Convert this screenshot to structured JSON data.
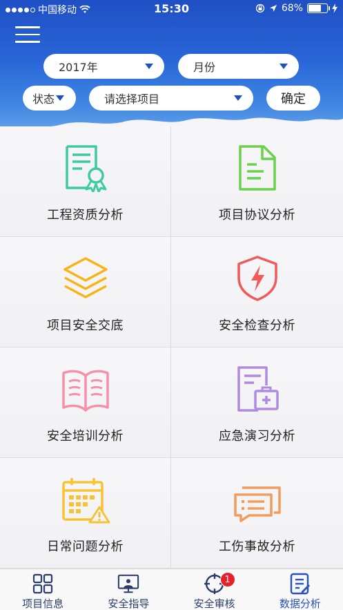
{
  "status_bar": {
    "carrier": "中国移动",
    "time": "15:30",
    "battery": "68%",
    "battery_level": 0.68
  },
  "filters": {
    "year": "2017年",
    "month": "月份",
    "status": "状态",
    "project_placeholder": "请选择项目",
    "confirm": "确定"
  },
  "tiles": [
    {
      "label": "工程资质分析",
      "icon": "certificate-icon",
      "color": "#3ccaa2"
    },
    {
      "label": "项目协议分析",
      "icon": "document-icon",
      "color": "#6bd04a"
    },
    {
      "label": "项目安全交底",
      "icon": "layers-icon",
      "color": "#f7b417"
    },
    {
      "label": "安全检查分析",
      "icon": "shield-lightning-icon",
      "color": "#f05a5a"
    },
    {
      "label": "安全培训分析",
      "icon": "open-book-icon",
      "color": "#f590a8"
    },
    {
      "label": "应急演习分析",
      "icon": "medical-kit-icon",
      "color": "#b08ae0"
    },
    {
      "label": "日常问题分析",
      "icon": "calendar-warning-icon",
      "color": "#f7c234"
    },
    {
      "label": "工伤事故分析",
      "icon": "message-alert-icon",
      "color": "#f39b5c"
    }
  ],
  "tabs": [
    {
      "label": "项目信息",
      "icon": "grid-icon"
    },
    {
      "label": "安全指导",
      "icon": "presentation-icon"
    },
    {
      "label": "安全审核",
      "icon": "target-icon",
      "badge": "1"
    },
    {
      "label": "数据分析",
      "icon": "data-report-icon",
      "active": true
    }
  ],
  "colors": {
    "header_blue": "#2a67d8",
    "caret_blue": "#1f52b8",
    "badge_red": "#e8202a",
    "tab_active": "#2753b8"
  }
}
